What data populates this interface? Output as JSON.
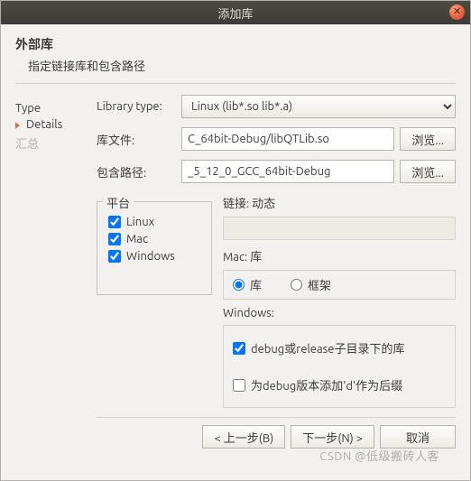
{
  "title": "添加库",
  "heading": "外部库",
  "subheading": "指定链接库和包含路径",
  "nav": {
    "type": "Type",
    "details": "Details",
    "summary": "汇总"
  },
  "form": {
    "library_type_label": "Library type:",
    "library_type_value": "Linux (lib*.so lib*.a)",
    "library_file_label": "库文件:",
    "library_file_value": "C_64bit-Debug/libQTLib.so",
    "include_path_label": "包含路径:",
    "include_path_value": "_5_12_0_GCC_64bit-Debug",
    "browse_label": "浏览..."
  },
  "platform": {
    "title": "平台",
    "linux": "Linux",
    "mac": "Mac",
    "windows": "Windows",
    "linux_checked": true,
    "mac_checked": true,
    "windows_checked": true
  },
  "link": {
    "label": "链接: 动态"
  },
  "mac": {
    "label": "Mac: 库",
    "lib": "库",
    "framework": "框架"
  },
  "windows": {
    "label": "Windows:",
    "debug_subdir": "debug或release子目录下的库",
    "add_d_suffix": "为debug版本添加'd'作为后缀"
  },
  "buttons": {
    "back": "< 上一步(B)",
    "next": "下一步(N) >",
    "cancel": "取消"
  },
  "watermark": "CSDN @低级搬砖人客"
}
